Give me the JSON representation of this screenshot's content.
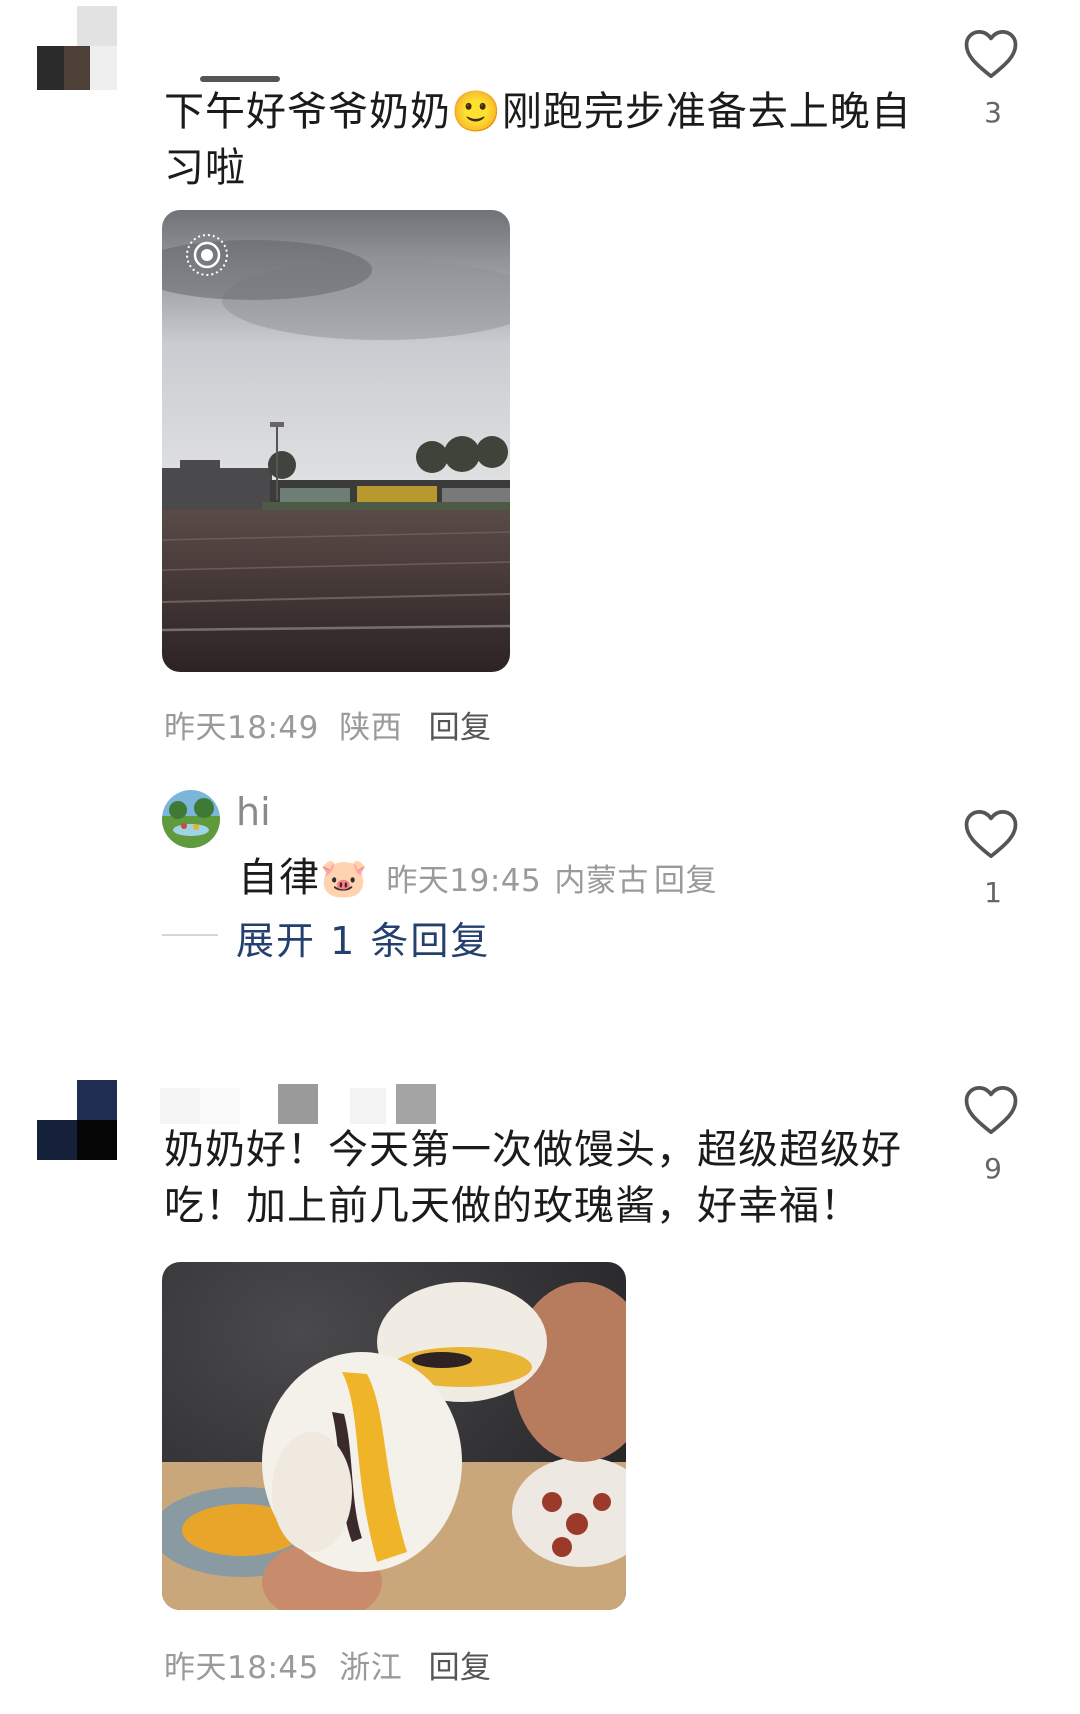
{
  "comments": [
    {
      "text": "下午好爷爷奶奶🙂刚跑完步准备去上晚自习啦",
      "text_line1": "下午好爷爷奶奶",
      "emoji1": "🙂",
      "text_line1b": "刚跑完步准备去上晚自",
      "text_line2": "习啦",
      "time": "昨天18:49",
      "location": "陕西",
      "reply_label": "回复",
      "likes": "3",
      "photo_icon": "live-photo-icon"
    },
    {
      "text_line1": "奶奶好！今天第一次做馒头，超级超级好",
      "text_line2": "吃！加上前几天做的玫瑰酱，好幸福！",
      "time": "昨天18:45",
      "location": "浙江",
      "reply_label": "回复",
      "likes": "9"
    }
  ],
  "reply": {
    "username": "hi",
    "text": "自律",
    "emoji": "🐷",
    "time": "昨天19:45",
    "location": "内蒙古",
    "reply_label": "回复",
    "likes": "1"
  },
  "expand_label": "展开 1 条回复",
  "colors": {
    "link": "#24406e",
    "meta": "#9a9a9a",
    "text": "#1b1b1b"
  },
  "icons": [
    "heart-outline-icon",
    "live-photo-icon"
  ]
}
